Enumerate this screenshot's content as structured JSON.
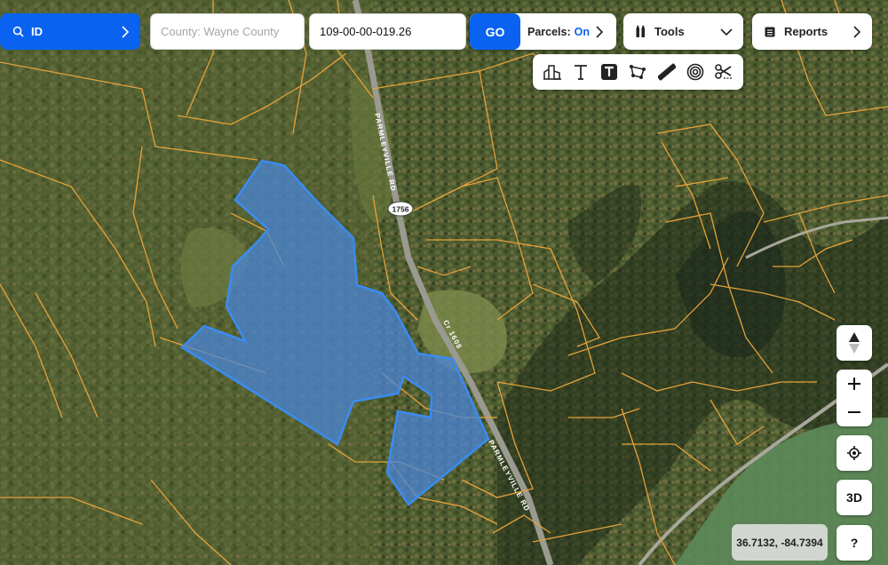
{
  "search": {
    "mode_label": "ID",
    "county_placeholder": "County: Wayne County",
    "parcel_id": "109-00-00-019.26",
    "go_label": "GO"
  },
  "parcels": {
    "label": "Parcels:",
    "state": "On"
  },
  "tools": {
    "label": "Tools"
  },
  "reports": {
    "label": "Reports"
  },
  "map": {
    "road_name_1": "PARMLEYVILLE RD",
    "road_name_2": "PARMLEYVILLE RD",
    "road_cr": "Cr 1608",
    "route_shield": "1756",
    "coordinates": "36.7132, -84.7394"
  },
  "controls": {
    "three_d": "3D",
    "help": "?"
  },
  "colors": {
    "accent": "#0a63f0",
    "parcel_line": "#e5a23a",
    "selection_fill": "#4a86d8",
    "selection_stroke": "#3a8cf0"
  },
  "icons": [
    "search-icon",
    "chevron-right-icon",
    "battery-tools-icon",
    "chevron-down-icon",
    "reports-list-icon",
    "buildings-icon",
    "text-icon",
    "text-box-icon",
    "polygon-icon",
    "ruler-icon",
    "buffer-circle-icon",
    "scissors-icon",
    "compass-icon",
    "zoom-in-icon",
    "zoom-out-icon",
    "locate-icon"
  ]
}
